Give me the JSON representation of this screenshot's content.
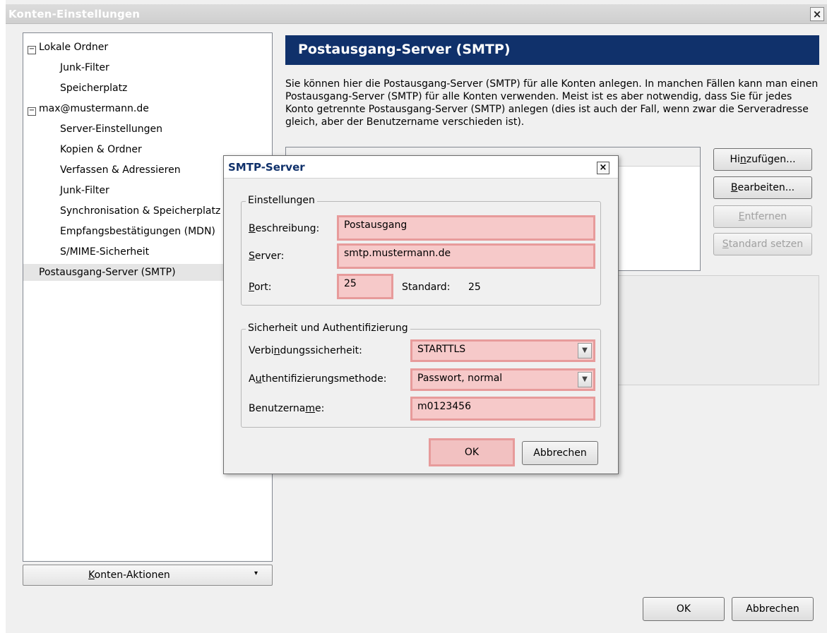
{
  "window": {
    "title": "Konten-Einstellungen",
    "close": "×"
  },
  "tree": {
    "items": [
      {
        "label": "Lokale Ordner",
        "expander": "−"
      },
      {
        "label": "Junk-Filter"
      },
      {
        "label": "Speicherplatz"
      },
      {
        "label": "max@mustermann.de",
        "expander": "−"
      },
      {
        "label": "Server-Einstellungen"
      },
      {
        "label": "Kopien & Ordner"
      },
      {
        "label": "Verfassen & Adressieren"
      },
      {
        "label": "Junk-Filter"
      },
      {
        "label": "Synchronisation & Speicherplatz"
      },
      {
        "label": "Empfangsbestätigungen (MDN)"
      },
      {
        "label": "S/MIME-Sicherheit"
      },
      {
        "label": "Postausgang-Server (SMTP)"
      }
    ]
  },
  "account_actions": {
    "k": "K",
    "rest": "onten-Aktionen",
    "arrow": "▾"
  },
  "panel": {
    "title": "Postausgang-Server (SMTP)",
    "description": "Sie können hier die Postausgang-Server (SMTP) für alle Konten anlegen. In manchen Fällen kann man einen Postausgang-Server (SMTP) für alle Konten verwenden. Meist ist es aber notwendig, dass Sie für jedes Konto getrennte Postausgang-Server (SMTP) anlegen (dies ist auch der Fall, wenn zwar die Serveradresse gleich, aber der Benutzername verschieden ist).",
    "buttons": {
      "add": {
        "pre": "Hi",
        "u": "n",
        "post": "zufügen..."
      },
      "edit": {
        "pre": "",
        "u": "B",
        "post": "earbeiten..."
      },
      "remove": {
        "pre": "",
        "u": "E",
        "post": "ntfernen"
      },
      "default": {
        "pre": "",
        "u": "S",
        "post": "tandard setzen"
      }
    }
  },
  "footer": {
    "ok": "OK",
    "cancel": "Abbrechen"
  },
  "dialog": {
    "title": "SMTP-Server",
    "close": "×",
    "settings": {
      "legend": "Einstellungen",
      "description_label": {
        "u": "B",
        "rest": "eschreibung:"
      },
      "description_value": "Postausgang",
      "server_label": {
        "u": "S",
        "rest": "erver:"
      },
      "server_value": "smtp.mustermann.de",
      "port_label": {
        "u": "P",
        "rest": "ort:"
      },
      "port_value": "25",
      "default_label": "Standard:",
      "default_value": "25"
    },
    "security": {
      "legend": "Sicherheit und Authentifizierung",
      "connection_label": {
        "pre": "Verbi",
        "u": "n",
        "post": "dungssicherheit:"
      },
      "connection_value": "STARTTLS",
      "auth_label": {
        "pre": "A",
        "u": "u",
        "post": "thentifizierungsmethode:"
      },
      "auth_value": "Passwort, normal",
      "username_label": {
        "pre": "Benutzerna",
        "u": "m",
        "post": "e:"
      },
      "username_value": "m0123456"
    },
    "ok": "OK",
    "cancel": "Abbrechen"
  },
  "colors": {
    "header_bg": "#10316b",
    "highlight": "#f6c9c9"
  }
}
